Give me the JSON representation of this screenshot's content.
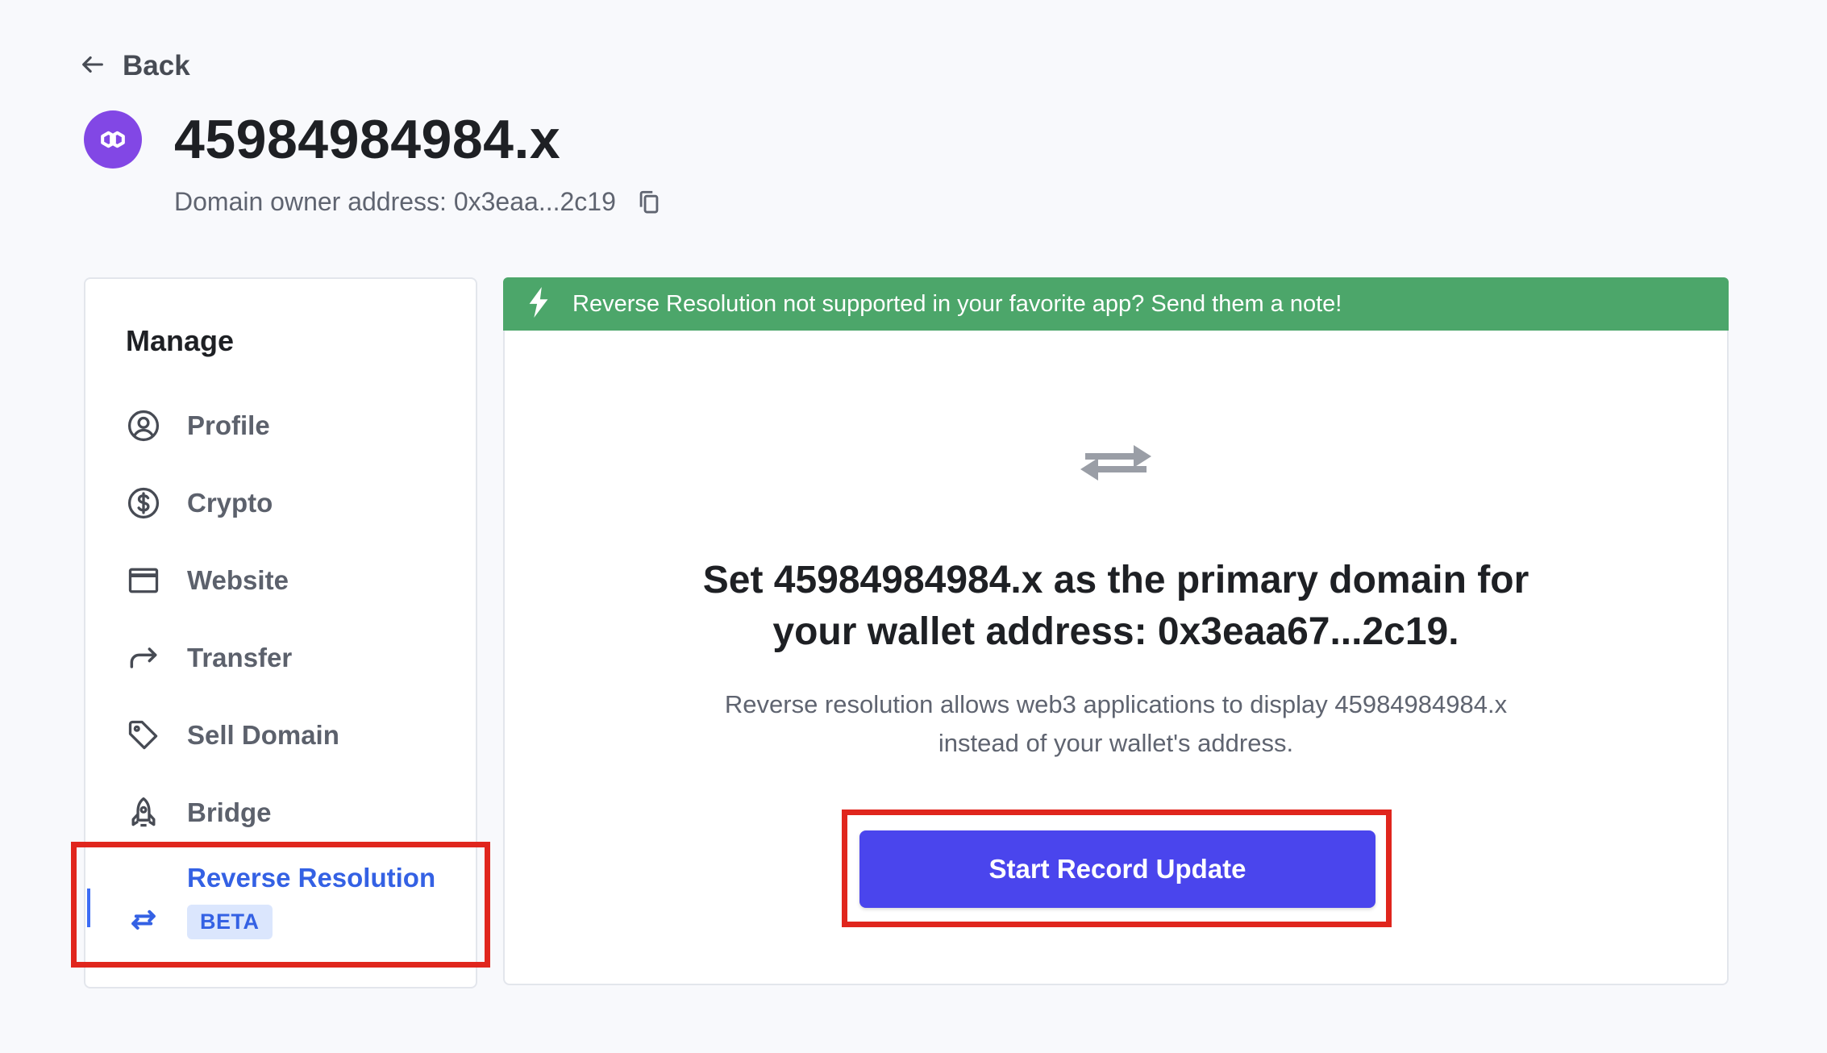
{
  "nav": {
    "back_label": "Back"
  },
  "domain": {
    "name": "45984984984.x",
    "owner_text": "Domain owner address: 0x3eaa...2c19"
  },
  "sidebar": {
    "title": "Manage",
    "items": [
      {
        "label": "Profile",
        "icon": "user-circle-icon"
      },
      {
        "label": "Crypto",
        "icon": "dollar-circle-icon"
      },
      {
        "label": "Website",
        "icon": "browser-window-icon"
      },
      {
        "label": "Transfer",
        "icon": "forward-arrow-icon"
      },
      {
        "label": "Sell Domain",
        "icon": "tag-icon"
      },
      {
        "label": "Bridge",
        "icon": "rocket-icon"
      },
      {
        "label": "Reverse Resolution",
        "icon": "swap-arrows-icon",
        "badge": "BETA",
        "active": true
      }
    ]
  },
  "banner": {
    "text": "Reverse Resolution not supported in your favorite app? Send them a note!",
    "icon": "lightning-icon"
  },
  "main": {
    "heading_line1": "Set 45984984984.x as the primary domain for",
    "heading_line2": "your wallet address: 0x3eaa67...2c19.",
    "desc_line1": "Reverse resolution allows web3 applications to display 45984984984.x",
    "desc_line2": "instead of your wallet's address.",
    "button_label": "Start Record Update"
  },
  "colors": {
    "accent": "#4a45ed",
    "active": "#3461e4",
    "banner": "#4ca66a",
    "highlight": "#e0261d",
    "polygon": "#8247e5"
  }
}
